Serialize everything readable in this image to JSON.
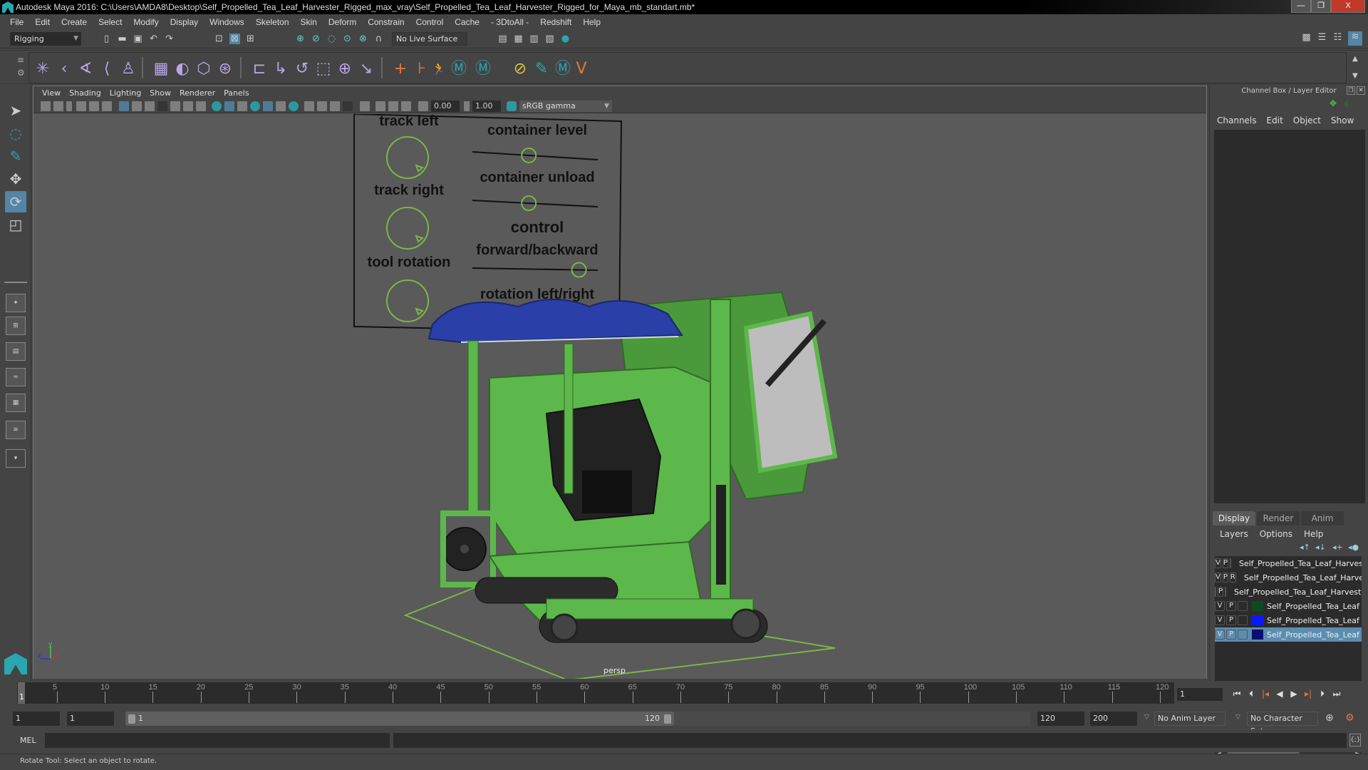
{
  "window": {
    "title": "Autodesk Maya 2016: C:\\Users\\AMDA8\\Desktop\\Self_Propelled_Tea_Leaf_Harvester_Rigged_max_vray\\Self_Propelled_Tea_Leaf_Harvester_Rigged_for_Maya_mb_standart.mb*",
    "minimize": "—",
    "restore": "❐",
    "close": "X"
  },
  "menubar": [
    "File",
    "Edit",
    "Create",
    "Select",
    "Modify",
    "Display",
    "Windows",
    "Skeleton",
    "Skin",
    "Deform",
    "Constrain",
    "Control",
    "Cache",
    "- 3DtoAll -",
    "Redshift",
    "Help"
  ],
  "statusline": {
    "mode": "Rigging",
    "live_surface": "No Live Surface"
  },
  "viewport": {
    "menu": [
      "View",
      "Shading",
      "Lighting",
      "Show",
      "Renderer",
      "Panels"
    ],
    "exposure": "0.00",
    "gamma": "1.00",
    "color_space": "sRGB gamma",
    "camera_label": "persp",
    "axis": {
      "x": "x",
      "y": "y",
      "z": "z"
    },
    "control_panel": {
      "dials": [
        "track left",
        "track right",
        "tool rotation"
      ],
      "sliders": [
        "container level",
        "container unload",
        "control",
        "forward/backward",
        "rotation left/right"
      ],
      "slider_positions": [
        0.45,
        0.45,
        0.85,
        0.9
      ]
    },
    "colors": {
      "body_green": "#5cb84a",
      "canopy_blue": "#2a3fa8",
      "control_green": "#7ab648"
    }
  },
  "channel_box": {
    "title": "Channel Box / Layer Editor",
    "menu": [
      "Channels",
      "Edit",
      "Object",
      "Show"
    ]
  },
  "layer_editor": {
    "tabs": [
      "Display",
      "Render",
      "Anim"
    ],
    "active_tab": "Display",
    "menu": [
      "Layers",
      "Options",
      "Help"
    ],
    "layers": [
      {
        "v": "V",
        "p": "P",
        "r": "",
        "color": "#6aa83a",
        "name": "Self_Propelled_Tea_Leaf_Harvester"
      },
      {
        "v": "V",
        "p": "P",
        "r": "R",
        "color": "#0d4a1f",
        "name": "Self_Propelled_Tea_Leaf_Harvester"
      },
      {
        "v": "",
        "p": "P",
        "r": "",
        "color": "#2a0b4a",
        "name": "Self_Propelled_Tea_Leaf_Harvester"
      },
      {
        "v": "V",
        "p": "P",
        "r": "",
        "color": "#0d4a1f",
        "name": "Self_Propelled_Tea_Leaf"
      },
      {
        "v": "V",
        "p": "P",
        "r": "",
        "color": "#0a1aff",
        "name": "Self_Propelled_Tea_Leaf"
      },
      {
        "v": "V",
        "p": "P",
        "r": "",
        "color": "#0a0f70",
        "name": "Self_Propelled_Tea_Leaf",
        "selected": true
      }
    ]
  },
  "timeline": {
    "ticks": [
      "5",
      "10",
      "15",
      "20",
      "25",
      "30",
      "35",
      "40",
      "45",
      "50",
      "55",
      "60",
      "65",
      "70",
      "75",
      "80",
      "85",
      "90",
      "95",
      "100",
      "105",
      "110",
      "115",
      "120"
    ],
    "current_frame_marker": "1",
    "current_frame": "1"
  },
  "range": {
    "start": "1",
    "playback_start": "1",
    "slider_start": "1",
    "slider_end": "120",
    "playback_end": "120",
    "end": "200",
    "anim_layer": "No Anim Layer",
    "character_set": "No Character Set"
  },
  "command_line": {
    "label": "MEL",
    "value": "",
    "result": ""
  },
  "help_line": "Rotate Tool: Select an object to rotate."
}
